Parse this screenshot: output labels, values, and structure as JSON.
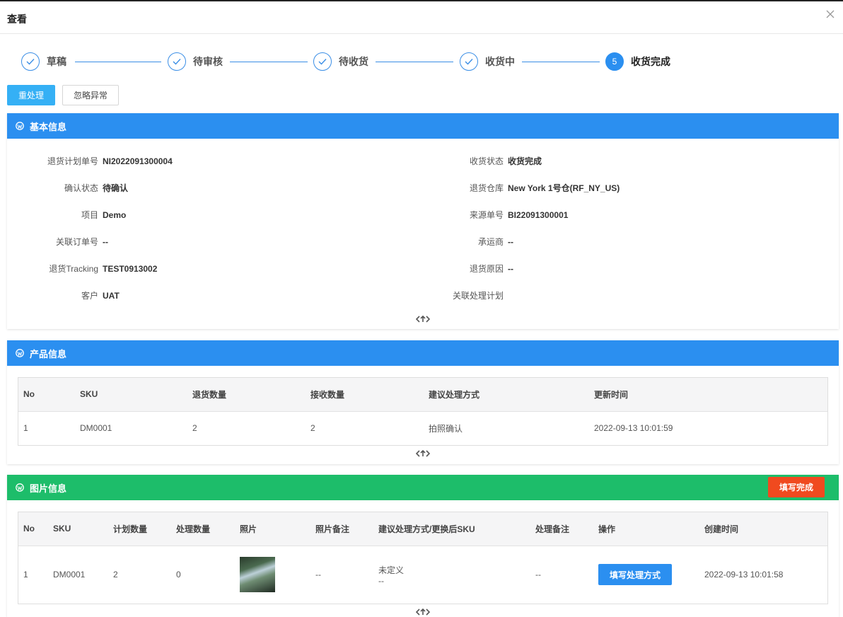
{
  "dialog": {
    "title": "查看"
  },
  "steps": [
    {
      "label": "草稿",
      "status": "done"
    },
    {
      "label": "待审核",
      "status": "done"
    },
    {
      "label": "待收货",
      "status": "done"
    },
    {
      "label": "收货中",
      "status": "done"
    },
    {
      "label": "收货完成",
      "status": "active",
      "number": "5"
    }
  ],
  "actions": {
    "reprocess": "重处理",
    "ignore": "忽略异常"
  },
  "basic": {
    "title": "基本信息",
    "left": [
      {
        "label": "退货计划单号",
        "value": "NI2022091300004"
      },
      {
        "label": "确认状态",
        "value": "待确认"
      },
      {
        "label": "项目",
        "value": "Demo"
      },
      {
        "label": "关联订单号",
        "value": "--"
      },
      {
        "label": "退货Tracking",
        "value": "TEST0913002"
      },
      {
        "label": "客户",
        "value": "UAT"
      }
    ],
    "right": [
      {
        "label": "收货状态",
        "value": "收货完成"
      },
      {
        "label": "退货仓库",
        "value": "New York 1号仓(RF_NY_US)"
      },
      {
        "label": "来源单号",
        "value": "BI22091300001"
      },
      {
        "label": "承运商",
        "value": "--"
      },
      {
        "label": "退货原因",
        "value": "--"
      },
      {
        "label": "关联处理计划",
        "value": ""
      }
    ]
  },
  "products": {
    "title": "产品信息",
    "columns": [
      "No",
      "SKU",
      "退货数量",
      "接收数量",
      "建议处理方式",
      "更新时间"
    ],
    "rows": [
      [
        "1",
        "DM0001",
        "2",
        "2",
        "拍照确认",
        "2022-09-13 10:01:59"
      ]
    ]
  },
  "images": {
    "title": "图片信息",
    "complete_button": "填写完成",
    "columns": [
      "No",
      "SKU",
      "计划数量",
      "处理数量",
      "照片",
      "照片备注",
      "建议处理方式/更换后SKU",
      "处理备注",
      "操作",
      "创建时间"
    ],
    "row": {
      "no": "1",
      "sku": "DM0001",
      "plan_qty": "2",
      "done_qty": "0",
      "photo_note": "--",
      "method": "未定义",
      "method_sku": "--",
      "process_note": "--",
      "action": "填写处理方式",
      "created": "2022-09-13 10:01:58"
    }
  },
  "colors": {
    "blue": "#2b8ff0",
    "green": "#1dbd6a",
    "red": "#f04a1f",
    "light_blue": "#35b0f5"
  }
}
